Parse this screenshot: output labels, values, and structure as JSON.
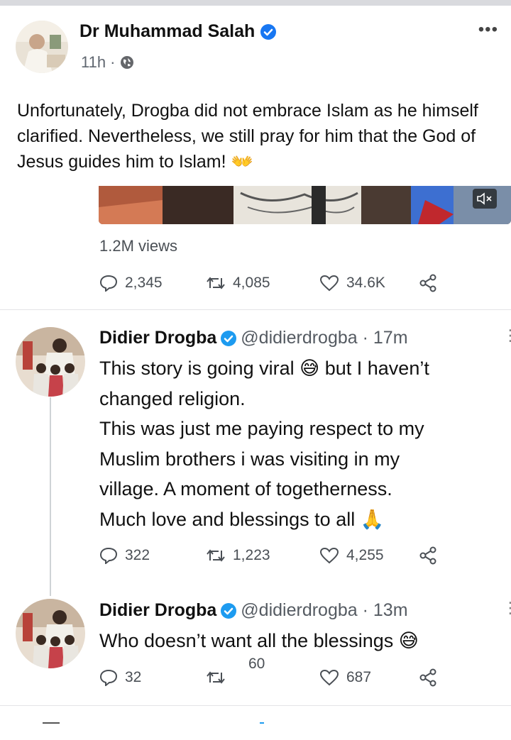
{
  "post": {
    "author": "Dr Muhammad Salah",
    "time": "11h ·",
    "more_icon": "•••",
    "text": "Unfortunately, Drogba did not embrace Islam as he himself clarified. Nevertheless, we still pray for him that the God of Jesus guides him to Islam!",
    "emoji": "👐"
  },
  "embedded_tweet": {
    "views": "1.2M views",
    "replies": "2,345",
    "retweets": "4,085",
    "likes": "34.6K"
  },
  "tweets": [
    {
      "name": "Didier Drogba",
      "handle": "@didierdrogba · 17m",
      "lines": [
        "This story is going viral 😅 but I haven’t",
        "changed religion.",
        "This was just me paying respect to my",
        "Muslim brothers i was visiting in my",
        "village. A moment of togetherness.",
        "Much love and blessings to all 🙏"
      ],
      "replies": "322",
      "retweets": "1,223",
      "likes": "4,255"
    },
    {
      "name": "Didier Drogba",
      "handle": "@didierdrogba · 13m",
      "lines": [
        "Who doesn’t want all the blessings 😅"
      ],
      "replies": "32",
      "retweets": "60",
      "likes": "687"
    }
  ],
  "colors": {
    "verified": "#1d9bf0",
    "text": "#111111",
    "muted": "#4a4f55"
  }
}
